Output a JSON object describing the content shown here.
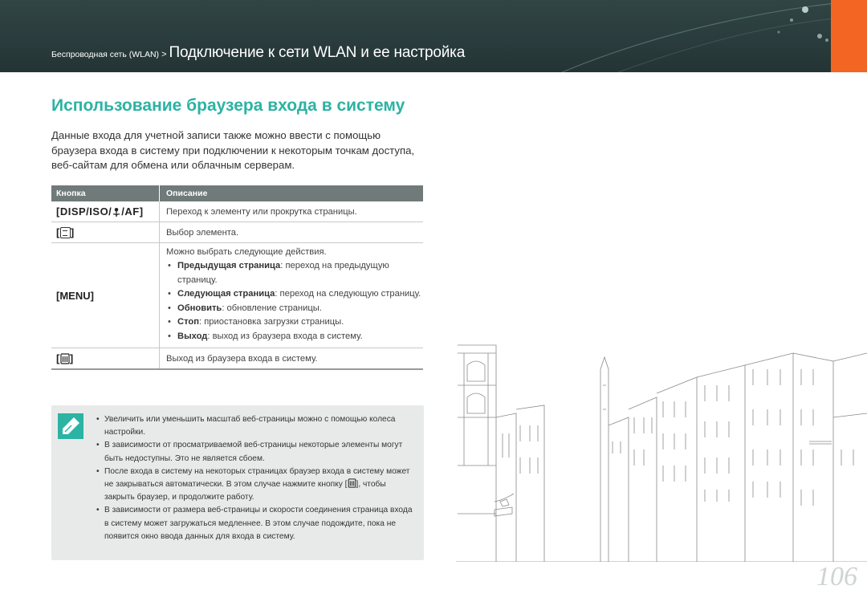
{
  "header": {
    "breadcrumb_small": "Беспроводная сеть (WLAN)",
    "separator": ">",
    "breadcrumb_big": "Подключение к сети WLAN и ее настройка",
    "accent_color": "#f26522"
  },
  "title": "Использование браузера входа в систему",
  "intro": "Данные входа для учетной записи также можно ввести с помощью браузера входа в систему при подключении к некоторым точкам доступа, веб-сайтам для обмена или облачным серверам.",
  "table": {
    "headers": [
      "Кнопка",
      "Описание"
    ],
    "rows": [
      {
        "key_prefix": "[DISP/ISO/",
        "key_suffix": "/AF]",
        "key_icon": "macro-flower-icon",
        "desc": "Переход к элементу или прокрутка страницы."
      },
      {
        "key_prefix": "[",
        "key_suffix": "]",
        "key_icon": "ok-button-icon",
        "desc": "Выбор элемента."
      },
      {
        "key": "[MENU]",
        "desc": "Можно выбрать следующие действия.",
        "options": [
          {
            "name": "Предыдущая страница",
            "text": ": переход на предыдущую страницу."
          },
          {
            "name": "Следующая страница",
            "text": ": переход на следующую страницу."
          },
          {
            "name": "Обновить",
            "text": ": обновление страницы."
          },
          {
            "name": "Стоп",
            "text": ": приостановка загрузки страницы."
          },
          {
            "name": "Выход",
            "text": ": выход из браузера входа в систему."
          }
        ]
      },
      {
        "key_prefix": "[",
        "key_suffix": "]",
        "key_icon": "delete-trash-icon",
        "desc": "Выход из браузера входа в систему."
      }
    ]
  },
  "note": {
    "icon": "pencil-note-icon",
    "items": [
      "Увеличить или уменьшить масштаб веб-страницы можно с помощью колеса настройки.",
      "В зависимости от просматриваемой веб-страницы некоторые элементы могут быть недоступны. Это не является сбоем."
    ],
    "item3_a": "После входа в систему на некоторых страницах браузер входа в систему может не закрываться автоматически. В этом случае нажмите кнопку [",
    "item3_b": "], чтобы закрыть браузер, и продолжите работу.",
    "item4": "В зависимости от размера веб-страницы и скорости соединения страница входа в систему может загружаться медленнее. В этом случае подождите, пока не появится окно ввода данных для входа в систему."
  },
  "page_number": "106"
}
